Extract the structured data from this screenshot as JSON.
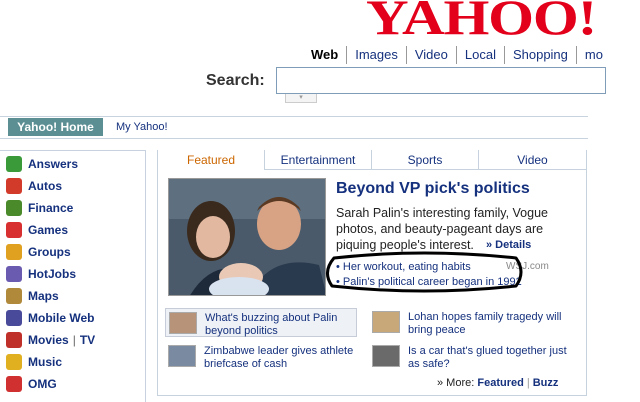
{
  "brand": {
    "logo_text": "YAHOO",
    "logo_bang": "!"
  },
  "search": {
    "tabs": [
      "Web",
      "Images",
      "Video",
      "Local",
      "Shopping",
      "mo"
    ],
    "active_tab": "Web",
    "label": "Search:",
    "value": "",
    "dropdown_glyph": "▾"
  },
  "nav": {
    "home_tab": "Yahoo! Home",
    "my_yahoo": "My Yahoo!"
  },
  "sidebar": {
    "items": [
      {
        "label": "Answers",
        "icon": "answers-icon",
        "color": "#3a9a3a"
      },
      {
        "label": "Autos",
        "icon": "car-icon",
        "color": "#d23a2a"
      },
      {
        "label": "Finance",
        "icon": "finance-icon",
        "color": "#4a8a2a"
      },
      {
        "label": "Games",
        "icon": "dice-icon",
        "color": "#d83030"
      },
      {
        "label": "Groups",
        "icon": "groups-icon",
        "color": "#e0a020"
      },
      {
        "label": "HotJobs",
        "icon": "hotjobs-icon",
        "color": "#6a5ab0"
      },
      {
        "label": "Maps",
        "icon": "map-icon",
        "color": "#b08a3a"
      },
      {
        "label": "Mobile Web",
        "icon": "mobile-icon",
        "color": "#4a4a9a"
      },
      {
        "label": "Movies",
        "label2": "TV",
        "icon": "movies-icon",
        "color": "#c0302a"
      },
      {
        "label": "Music",
        "icon": "music-icon",
        "color": "#e0b020"
      },
      {
        "label": "OMG",
        "icon": "omg-icon",
        "color": "#d03030"
      }
    ]
  },
  "featured": {
    "tabs": [
      "Featured",
      "Entertainment",
      "Sports",
      "Video"
    ],
    "active_tab": "Featured",
    "headline": "Beyond VP pick's politics",
    "summary": "Sarah Palin's interesting family, Vogue photos, and beauty-pageant days are piquing people's interest.",
    "details_link": "» Details",
    "bullets": [
      {
        "text": "• Her workout, eating habits",
        "source": "WSJ.com"
      },
      {
        "text": "• Palin's political career began in 1992",
        "source": ""
      }
    ],
    "annotation_color": "#000000"
  },
  "stories": [
    {
      "text": "What's buzzing about Palin beyond politics",
      "thumb": "palin-thumb",
      "highlight": true
    },
    {
      "text": "Lohan hopes family tragedy will bring peace",
      "thumb": "lohan-thumb",
      "highlight": false
    },
    {
      "text": "Zimbabwe leader gives athlete briefcase of cash",
      "thumb": "athlete-thumb",
      "highlight": false
    },
    {
      "text": "Is a car that's glued together just as safe?",
      "thumb": "car-thumb",
      "highlight": false
    }
  ],
  "more": {
    "prefix": "» More:",
    "featured": "Featured",
    "buzz": "Buzz"
  },
  "colors": {
    "brand_red": "#e3001b",
    "link_blue": "#15317e",
    "active_tab_orange": "#cc6600",
    "home_tab_bg": "#5b8f93"
  }
}
